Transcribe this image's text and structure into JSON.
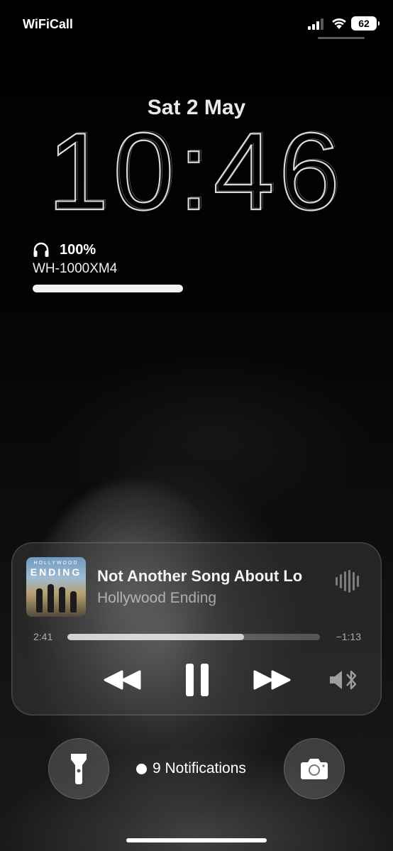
{
  "status_bar": {
    "carrier": "WiFiCall",
    "battery": "62"
  },
  "lock": {
    "date": "Sat 2 May",
    "time": "10:46"
  },
  "headphones_widget": {
    "percent_label": "100%",
    "device_name": "WH-1000XM4",
    "level_fraction": 1.0
  },
  "now_playing": {
    "album_art_text_top": "HOLLYWOOD",
    "album_art_text_main": "ENDING",
    "song_title": "Not Another Song About Lo",
    "artist": "Hollywood Ending",
    "elapsed": "2:41",
    "remaining": "−1:13",
    "progress_fraction": 0.7,
    "icons": {
      "rewind": "rewind-icon",
      "pause": "pause-icon",
      "forward": "fast-forward-icon",
      "output": "speaker-bluetooth-icon",
      "waveform": "waveform-icon"
    }
  },
  "bottom": {
    "notifications_label": "9 Notifications",
    "flashlight_icon": "flashlight-icon",
    "camera_icon": "camera-icon"
  }
}
